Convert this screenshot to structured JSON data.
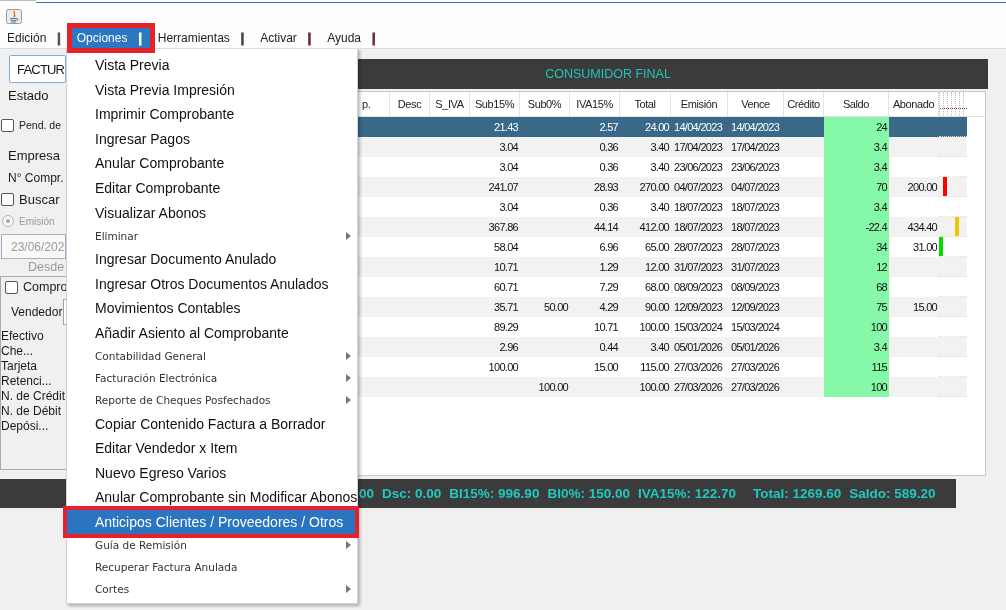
{
  "menu_bar": [
    {
      "label": "Edición",
      "separator": {
        "text": "|",
        "color": "#4a4a4a"
      },
      "selected": false,
      "annotated": false
    },
    {
      "label": "Opciones",
      "separator": {
        "text": "|",
        "color": "#ffffff"
      },
      "selected": true,
      "annotated": true
    },
    {
      "label": "Herramientas",
      "separator": {
        "text": "|",
        "color": "#4a4a4a"
      },
      "selected": false,
      "annotated": false
    },
    {
      "label": "Activar",
      "separator": {
        "text": "|",
        "color": "#7a2048"
      },
      "selected": false,
      "annotated": false
    },
    {
      "label": "Ayuda",
      "separator": {
        "text": "|",
        "color": "#7a2048"
      },
      "selected": false,
      "annotated": false
    }
  ],
  "options_menu": {
    "items": [
      {
        "label": "Vista Previa",
        "kind": "large",
        "submenu": false,
        "selected": false,
        "annotated": false
      },
      {
        "label": "Vista Previa Impresión",
        "kind": "large",
        "submenu": false,
        "selected": false,
        "annotated": false
      },
      {
        "label": "Imprimir Comprobante",
        "kind": "large",
        "submenu": false,
        "selected": false,
        "annotated": false
      },
      {
        "label": "Ingresar Pagos",
        "kind": "large",
        "submenu": false,
        "selected": false,
        "annotated": false
      },
      {
        "label": "Anular Comprobante",
        "kind": "large",
        "submenu": false,
        "selected": false,
        "annotated": false
      },
      {
        "label": "Editar Comprobante",
        "kind": "large",
        "submenu": false,
        "selected": false,
        "annotated": false
      },
      {
        "label": "Visualizar Abonos",
        "kind": "large",
        "submenu": false,
        "selected": false,
        "annotated": false
      },
      {
        "label": "Eliminar",
        "kind": "small",
        "submenu": true,
        "selected": false,
        "annotated": false
      },
      {
        "label": "Ingresar Documento Anulado",
        "kind": "large",
        "submenu": false,
        "selected": false,
        "annotated": false
      },
      {
        "label": "Ingresar Otros Documentos Anulados",
        "kind": "large",
        "submenu": false,
        "selected": false,
        "annotated": false
      },
      {
        "label": "Movimientos Contables",
        "kind": "large",
        "submenu": false,
        "selected": false,
        "annotated": false
      },
      {
        "label": "Añadir Asiento al Comprobante",
        "kind": "large",
        "submenu": false,
        "selected": false,
        "annotated": false
      },
      {
        "label": "Contabilidad General",
        "kind": "small",
        "submenu": true,
        "selected": false,
        "annotated": false
      },
      {
        "label": "Facturación Electrónica",
        "kind": "small",
        "submenu": true,
        "selected": false,
        "annotated": false
      },
      {
        "label": "Reporte de Cheques Posfechados",
        "kind": "small",
        "submenu": true,
        "selected": false,
        "annotated": false
      },
      {
        "label": "Copiar Contenido Factura a Borrador",
        "kind": "large",
        "submenu": false,
        "selected": false,
        "annotated": false
      },
      {
        "label": "Editar Vendedor x Item",
        "kind": "large",
        "submenu": false,
        "selected": false,
        "annotated": false
      },
      {
        "label": "Nuevo Egreso Varios",
        "kind": "large",
        "submenu": false,
        "selected": false,
        "annotated": false
      },
      {
        "label": "Anular Comprobante sin Modificar Abonos",
        "kind": "large",
        "submenu": false,
        "selected": false,
        "annotated": false
      },
      {
        "label": "Anticipos Clientes / Proveedores / Otros",
        "kind": "large",
        "submenu": false,
        "selected": true,
        "annotated": true
      },
      {
        "label": "Guía de Remisión",
        "kind": "small",
        "submenu": true,
        "selected": false,
        "annotated": false
      },
      {
        "label": "Recuperar Factura Anulada",
        "kind": "small",
        "submenu": false,
        "selected": false,
        "annotated": false
      },
      {
        "label": "Cortes",
        "kind": "small",
        "submenu": true,
        "selected": false,
        "annotated": false
      }
    ]
  },
  "filter_panel": {
    "document_type": {
      "value": "FACTUR"
    },
    "status_label": "Estado",
    "pending_check": {
      "label": "Pend. de",
      "checked": false
    },
    "company_label": "Empresa",
    "number_label": "N° Compr.",
    "search_check": {
      "label": "Buscar",
      "checked": false
    },
    "date_option": {
      "label": "Emisión",
      "selected": true,
      "disabled": true
    },
    "date_field": {
      "value": "23/06/202",
      "disabled": true
    },
    "date_caption": "Desde",
    "payments_panel": {
      "check": {
        "label": "Compro",
        "checked": false
      },
      "vendor_label": "Vendedor",
      "types": [
        "Efectivo",
        "Che...",
        "Tarjeta",
        "Retenci...",
        "N. de Crédit",
        "N. de Débit",
        "Depósi..."
      ]
    }
  },
  "client_banner": {
    "text": "CONSUMIDOR FINAL"
  },
  "table": {
    "columns": [
      {
        "label": "p.",
        "kind": "plain"
      },
      {
        "label": "Desc",
        "kind": "plain"
      },
      {
        "label": "S_IVA",
        "kind": "plain"
      },
      {
        "label": "Sub15%",
        "kind": "plain"
      },
      {
        "label": "Sub0%",
        "kind": "plain"
      },
      {
        "label": "IVA15%",
        "kind": "plain"
      },
      {
        "label": "Total",
        "kind": "plain"
      },
      {
        "label": "Emisión",
        "kind": "plain"
      },
      {
        "label": "Vence",
        "kind": "plain"
      },
      {
        "label": "Crédito",
        "kind": "plain"
      },
      {
        "label": "Saldo",
        "kind": "highlighted"
      },
      {
        "label": "Abonado",
        "kind": "plain"
      }
    ],
    "rows": [
      {
        "selected": true,
        "sub15": "21.43",
        "iva15": "2.57",
        "total": "24.00",
        "emision": "14/04/2023",
        "vence": "14/04/2023",
        "saldo": "24"
      },
      {
        "selected": false,
        "sub15": "3.04",
        "iva15": "0.36",
        "total": "3.40",
        "emision": "17/04/2023",
        "vence": "17/04/2023",
        "saldo": "3.4"
      },
      {
        "selected": false,
        "sub15": "3.04",
        "iva15": "0.36",
        "total": "3.40",
        "emision": "23/06/2023",
        "vence": "23/06/2023",
        "saldo": "3.4"
      },
      {
        "selected": false,
        "sub15": "241.07",
        "iva15": "28.93",
        "total": "270.00",
        "emision": "04/07/2023",
        "vence": "04/07/2023",
        "saldo": "70",
        "abonado": "200.00",
        "marker_2": {
          "color": "#ff0000"
        }
      },
      {
        "selected": false,
        "sub15": "3.04",
        "iva15": "0.36",
        "total": "3.40",
        "emision": "18/07/2023",
        "vence": "18/07/2023",
        "saldo": "3.4"
      },
      {
        "selected": false,
        "sub15": "367.86",
        "iva15": "44.14",
        "total": "412.00",
        "emision": "18/07/2023",
        "vence": "18/07/2023",
        "saldo": "-22.4",
        "abonado": "434.40",
        "marker_5": {
          "color": "#e8c800"
        }
      },
      {
        "selected": false,
        "sub15": "58.04",
        "iva15": "6.96",
        "total": "65.00",
        "emision": "28/07/2023",
        "vence": "28/07/2023",
        "saldo": "34",
        "abonado": "31.00",
        "marker_1": {
          "color": "#00dd00"
        }
      },
      {
        "selected": false,
        "sub15": "10.71",
        "iva15": "1.29",
        "total": "12.00",
        "emision": "31/07/2023",
        "vence": "31/07/2023",
        "saldo": "12"
      },
      {
        "selected": false,
        "sub15": "60.71",
        "iva15": "7.29",
        "total": "68.00",
        "emision": "08/09/2023",
        "vence": "08/09/2023",
        "saldo": "68"
      },
      {
        "selected": false,
        "sub15": "35.71",
        "sub0": "50.00",
        "iva15": "4.29",
        "total": "90.00",
        "emision": "12/09/2023",
        "vence": "12/09/2023",
        "saldo": "75",
        "abonado": "15.00"
      },
      {
        "selected": false,
        "sub15": "89.29",
        "iva15": "10.71",
        "total": "100.00",
        "emision": "15/03/2024",
        "vence": "15/03/2024",
        "saldo": "100"
      },
      {
        "selected": false,
        "sub15": "2.96",
        "iva15": "0.44",
        "total": "3.40",
        "emision": "05/01/2026",
        "vence": "05/01/2026",
        "saldo": "3.4"
      },
      {
        "selected": false,
        "sub15": "100.00",
        "iva15": "15.00",
        "total": "115.00",
        "emision": "27/03/2026",
        "vence": "27/03/2026",
        "saldo": "115"
      },
      {
        "selected": false,
        "sub0": "100.00",
        "total": "100.00",
        "emision": "27/03/2026",
        "vence": "27/03/2026",
        "saldo": "100"
      }
    ]
  },
  "totals_bar": {
    "groups": [
      [
        "00",
        "Dsc: 0.00",
        "BI15%: 996.90",
        "BI0%: 150.00",
        "IVA15%: 122.70"
      ],
      [
        "Total: 1269.60",
        "Saldo: 589.20"
      ]
    ]
  }
}
